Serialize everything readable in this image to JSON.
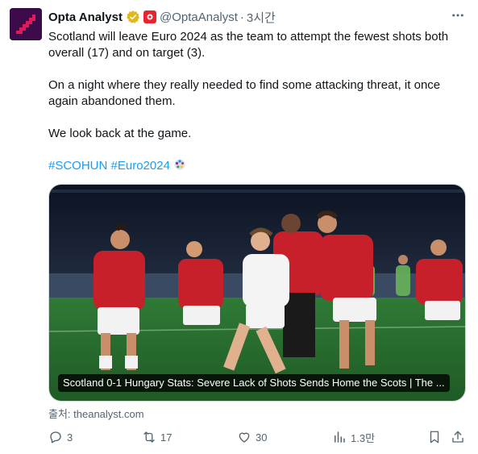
{
  "author": {
    "name": "Opta Analyst",
    "handle": "@OptaAnalyst",
    "time": "3시간"
  },
  "tweet": {
    "paragraphs": [
      "Scotland will leave Euro 2024 as the team to attempt the fewest shots both overall (17) and on target (3).",
      "On a night where they really needed to find some attacking threat, it once again abandoned them.",
      "We look back at the game."
    ],
    "hashtags": [
      "#SCOHUN",
      "#Euro2024"
    ]
  },
  "card": {
    "title": "Scotland 0-1 Hungary Stats: Severe Lack of Shots Sends Home the Scots | The ...",
    "source": "출처: theanalyst.com"
  },
  "stats": {
    "replies": "3",
    "retweets": "17",
    "likes": "30",
    "views": "1.3만"
  },
  "colors": {
    "link": "#1d9bf0",
    "secondary_text": "#536471",
    "avatar_bg": "#3b0b4a",
    "avatar_accent": "#e0195a",
    "hungary_red": "#c8202a"
  }
}
